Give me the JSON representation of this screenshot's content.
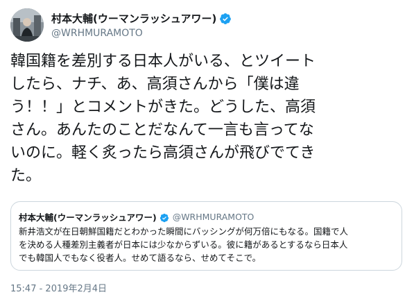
{
  "author": {
    "display_name": "村本大輔(ウーマンラッシュアワー)",
    "handle": "@WRHMURAMOTO",
    "avatar_icon": "avatar-photo",
    "verified_icon": "verified-badge-icon"
  },
  "tweet": {
    "text": "韓国籍を差別する日本人がいる、とツイート\nしたら、ナチ、あ、高須さんから「僕は違\nう！！」とコメントがきた。どうした、高須\nさん。あんたのことだなんて一言も言ってな\nいのに。軽く炙ったら高須さんが飛びでてき\nた。",
    "timestamp": "15:47 - 2019年2月4日"
  },
  "quoted_tweet": {
    "display_name": "村本大輔(ウーマンラッシュアワー)",
    "handle": "@WRHMURAMOTO",
    "text": "新井浩文が在日朝鮮国籍だとわかった瞬間にバッシングが何万倍にもなる。国籍で人\nを決める人種差別主義者が日本には少なからずいる。彼に籍があるとするなら日本人\nでも韓国人でもなく役者人。せめて語るなら、せめてそこで。"
  },
  "colors": {
    "text": "#14171a",
    "secondary": "#657786",
    "verified": "#1da1f2",
    "border": "#ccd6dd"
  }
}
